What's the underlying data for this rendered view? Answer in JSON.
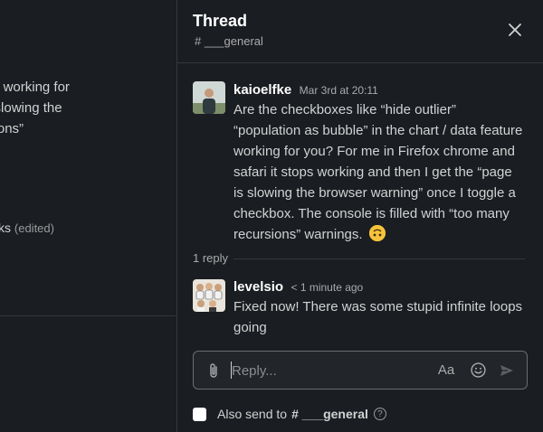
{
  "left_pane": {
    "message_lines": [
      "/ data feature working for",
      "the “page is slowing the",
      "many recursions”"
    ],
    "edited_prefix": "ks",
    "edited_label": "(edited)"
  },
  "thread": {
    "title": "Thread",
    "channel": "# ___general",
    "close_icon": "close-icon"
  },
  "messages": [
    {
      "author": "kaioelfke",
      "time": "Mar 3rd at 20:11",
      "text": "Are the checkboxes like “hide outlier” “population as bubble” in the chart / data feature working for you? For me in Firefox chrome and safari it stops working and then I get the “page is slowing the browser warning” once I toggle a checkbox. The console is filled with “too many recursions” warnings.",
      "emoji": "upside-down-face"
    },
    {
      "author": "levelsio",
      "time": "< 1 minute ago",
      "text": "Fixed now! There was some stupid infinite loops going"
    }
  ],
  "reply_count": "1 reply",
  "composer": {
    "placeholder": "Reply...",
    "format_label": "Aa",
    "icons": [
      "paperclip-icon",
      "emoji-icon",
      "send-icon"
    ]
  },
  "also_send": {
    "label": "Also send to",
    "channel": "# ___general",
    "checked": false
  },
  "colors": {
    "background": "#1a1d21",
    "border": "#35373b",
    "text": "#d1d2d3",
    "emoji": "#f5c33b"
  }
}
